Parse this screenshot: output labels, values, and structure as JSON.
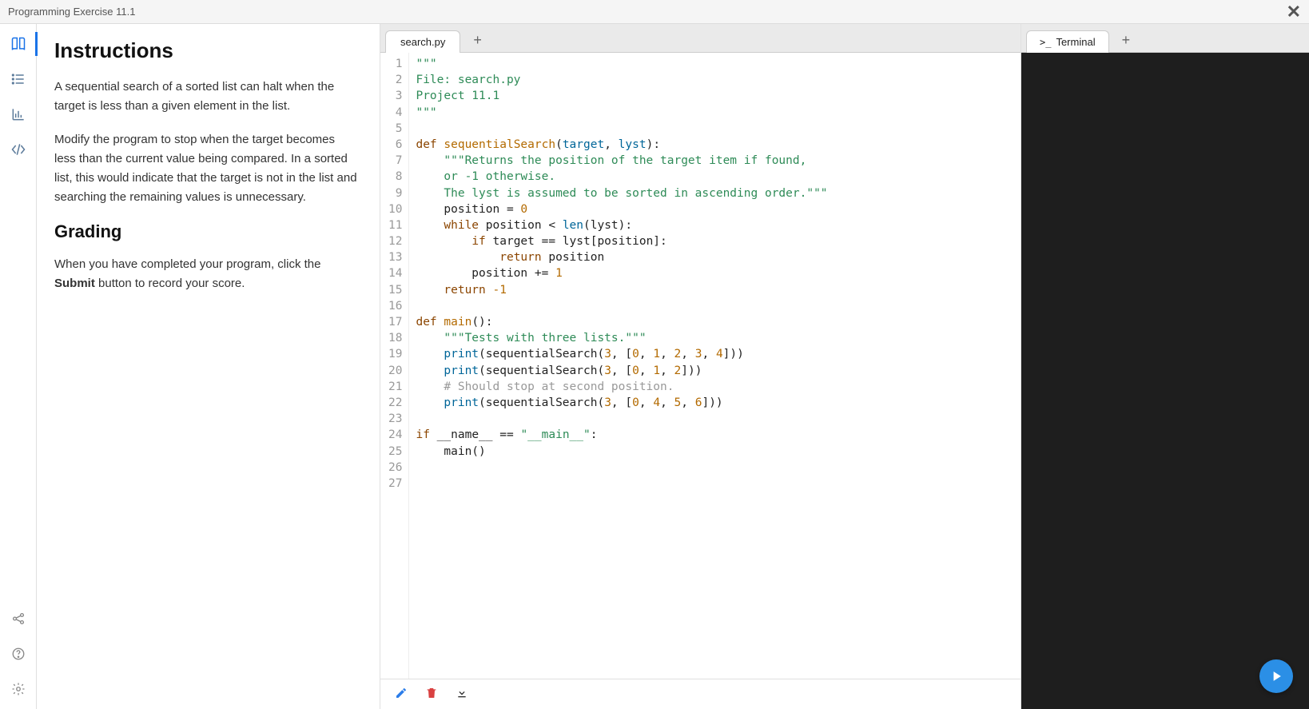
{
  "window": {
    "title": "Programming Exercise 11.1"
  },
  "instructions": {
    "heading": "Instructions",
    "p1": "A sequential search of a sorted list can halt when the target is less than a given element in the list.",
    "p2": "Modify the program to stop when the target becomes less than the current value being compared. In a sorted list, this would indicate that the target is not in the list and searching the remaining values is unnecessary.",
    "h2": "Grading",
    "p3_pre": "When you have completed your program, click the ",
    "p3_bold": "Submit",
    "p3_post": " button to record your score."
  },
  "editor": {
    "filename": "search.py",
    "lines": [
      [
        {
          "cls": "str",
          "t": "\"\"\""
        }
      ],
      [
        {
          "cls": "str",
          "t": "File: search.py"
        }
      ],
      [
        {
          "cls": "str",
          "t": "Project 11.1"
        }
      ],
      [
        {
          "cls": "str",
          "t": "\"\"\""
        }
      ],
      [
        {
          "cls": "",
          "t": ""
        }
      ],
      [
        {
          "cls": "kw",
          "t": "def "
        },
        {
          "cls": "fn",
          "t": "sequentialSearch"
        },
        {
          "cls": "",
          "t": "("
        },
        {
          "cls": "arg",
          "t": "target"
        },
        {
          "cls": "",
          "t": ", "
        },
        {
          "cls": "arg",
          "t": "lyst"
        },
        {
          "cls": "",
          "t": "):"
        }
      ],
      [
        {
          "cls": "",
          "t": "    "
        },
        {
          "cls": "str",
          "t": "\"\"\"Returns the position of the target item if found,"
        }
      ],
      [
        {
          "cls": "",
          "t": "    "
        },
        {
          "cls": "str",
          "t": "or -1 otherwise."
        }
      ],
      [
        {
          "cls": "",
          "t": "    "
        },
        {
          "cls": "str",
          "t": "The lyst is assumed to be sorted in ascending order.\"\"\""
        }
      ],
      [
        {
          "cls": "",
          "t": "    position = "
        },
        {
          "cls": "num",
          "t": "0"
        }
      ],
      [
        {
          "cls": "",
          "t": "    "
        },
        {
          "cls": "kw",
          "t": "while"
        },
        {
          "cls": "",
          "t": " position < "
        },
        {
          "cls": "builtin",
          "t": "len"
        },
        {
          "cls": "",
          "t": "(lyst):"
        }
      ],
      [
        {
          "cls": "",
          "t": "        "
        },
        {
          "cls": "kw",
          "t": "if"
        },
        {
          "cls": "",
          "t": " target == lyst[position]:"
        }
      ],
      [
        {
          "cls": "",
          "t": "            "
        },
        {
          "cls": "kw",
          "t": "return"
        },
        {
          "cls": "",
          "t": " position"
        }
      ],
      [
        {
          "cls": "",
          "t": "        position += "
        },
        {
          "cls": "num",
          "t": "1"
        }
      ],
      [
        {
          "cls": "",
          "t": "    "
        },
        {
          "cls": "kw",
          "t": "return"
        },
        {
          "cls": "",
          "t": " "
        },
        {
          "cls": "num",
          "t": "-1"
        }
      ],
      [
        {
          "cls": "",
          "t": ""
        }
      ],
      [
        {
          "cls": "kw",
          "t": "def "
        },
        {
          "cls": "fn",
          "t": "main"
        },
        {
          "cls": "",
          "t": "():"
        }
      ],
      [
        {
          "cls": "",
          "t": "    "
        },
        {
          "cls": "str",
          "t": "\"\"\"Tests with three lists.\"\"\""
        }
      ],
      [
        {
          "cls": "",
          "t": "    "
        },
        {
          "cls": "builtin",
          "t": "print"
        },
        {
          "cls": "",
          "t": "(sequentialSearch("
        },
        {
          "cls": "num",
          "t": "3"
        },
        {
          "cls": "",
          "t": ", ["
        },
        {
          "cls": "num",
          "t": "0"
        },
        {
          "cls": "",
          "t": ", "
        },
        {
          "cls": "num",
          "t": "1"
        },
        {
          "cls": "",
          "t": ", "
        },
        {
          "cls": "num",
          "t": "2"
        },
        {
          "cls": "",
          "t": ", "
        },
        {
          "cls": "num",
          "t": "3"
        },
        {
          "cls": "",
          "t": ", "
        },
        {
          "cls": "num",
          "t": "4"
        },
        {
          "cls": "",
          "t": "]))"
        }
      ],
      [
        {
          "cls": "",
          "t": "    "
        },
        {
          "cls": "builtin",
          "t": "print"
        },
        {
          "cls": "",
          "t": "(sequentialSearch("
        },
        {
          "cls": "num",
          "t": "3"
        },
        {
          "cls": "",
          "t": ", ["
        },
        {
          "cls": "num",
          "t": "0"
        },
        {
          "cls": "",
          "t": ", "
        },
        {
          "cls": "num",
          "t": "1"
        },
        {
          "cls": "",
          "t": ", "
        },
        {
          "cls": "num",
          "t": "2"
        },
        {
          "cls": "",
          "t": "]))"
        }
      ],
      [
        {
          "cls": "",
          "t": "    "
        },
        {
          "cls": "cmt",
          "t": "# Should stop at second position."
        }
      ],
      [
        {
          "cls": "",
          "t": "    "
        },
        {
          "cls": "builtin",
          "t": "print"
        },
        {
          "cls": "",
          "t": "(sequentialSearch("
        },
        {
          "cls": "num",
          "t": "3"
        },
        {
          "cls": "",
          "t": ", ["
        },
        {
          "cls": "num",
          "t": "0"
        },
        {
          "cls": "",
          "t": ", "
        },
        {
          "cls": "num",
          "t": "4"
        },
        {
          "cls": "",
          "t": ", "
        },
        {
          "cls": "num",
          "t": "5"
        },
        {
          "cls": "",
          "t": ", "
        },
        {
          "cls": "num",
          "t": "6"
        },
        {
          "cls": "",
          "t": "]))"
        }
      ],
      [
        {
          "cls": "",
          "t": ""
        }
      ],
      [
        {
          "cls": "kw",
          "t": "if"
        },
        {
          "cls": "",
          "t": " __name__ == "
        },
        {
          "cls": "str",
          "t": "\"__main__\""
        },
        {
          "cls": "",
          "t": ":"
        }
      ],
      [
        {
          "cls": "",
          "t": "    main()"
        }
      ],
      [
        {
          "cls": "",
          "t": ""
        }
      ],
      [
        {
          "cls": "",
          "t": ""
        }
      ]
    ]
  },
  "terminal": {
    "label": "Terminal"
  }
}
